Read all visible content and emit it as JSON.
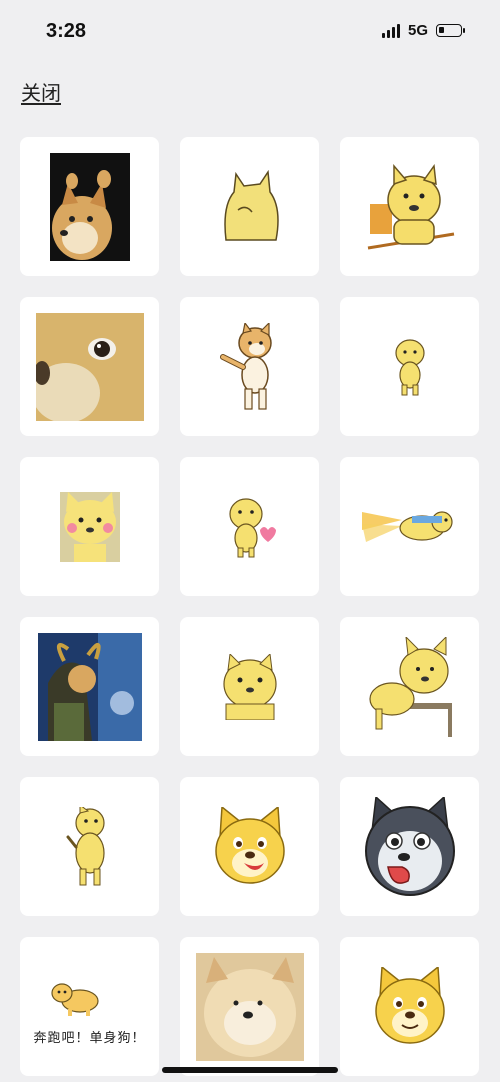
{
  "status_bar": {
    "time": "3:28",
    "network": "5G",
    "signal_bars": 4,
    "battery_level": 0.15,
    "icons": [
      "signal-icon",
      "battery-icon"
    ]
  },
  "header": {
    "close_label": "关闭"
  },
  "stickers": [
    {
      "name": "doge-photo-black-bg",
      "caption": ""
    },
    {
      "name": "doge-back-view",
      "caption": ""
    },
    {
      "name": "doge-on-chair",
      "caption": ""
    },
    {
      "name": "doge-eye-closeup",
      "caption": ""
    },
    {
      "name": "shiba-dancing",
      "caption": ""
    },
    {
      "name": "doge-small-standing",
      "caption": ""
    },
    {
      "name": "doge-blushing",
      "caption": ""
    },
    {
      "name": "doge-holding-heart",
      "caption": ""
    },
    {
      "name": "doge-flying-sword",
      "caption": ""
    },
    {
      "name": "loki-doge",
      "caption": ""
    },
    {
      "name": "doge-face-zoom",
      "caption": ""
    },
    {
      "name": "doge-leaning-table",
      "caption": ""
    },
    {
      "name": "doge-standing-side",
      "caption": ""
    },
    {
      "name": "doge-emoji-tongue",
      "caption": ""
    },
    {
      "name": "husky-emoji-tongue",
      "caption": ""
    },
    {
      "name": "doge-running",
      "caption": "奔跑吧！单身狗！"
    },
    {
      "name": "doge-fluffy-photo",
      "caption": ""
    },
    {
      "name": "doge-emoji-smile",
      "caption": ""
    }
  ]
}
